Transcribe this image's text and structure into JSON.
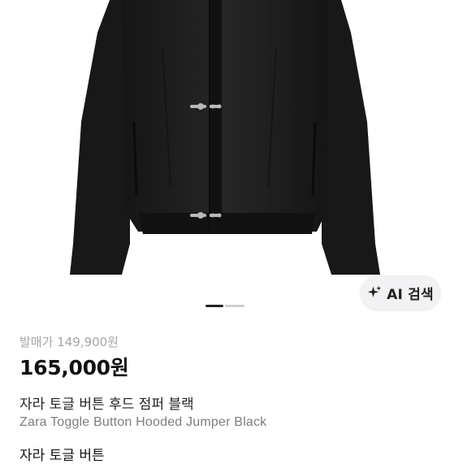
{
  "product": {
    "retail_price_label": "발매가 149,900원",
    "price": "165,000원",
    "title_ko": "자라 토글 버튼 후드 점퍼 블랙",
    "title_en": "Zara Toggle Button Hooded Jumper Black",
    "partial_text": "자라 토글 버튼"
  },
  "image_carousel": {
    "ai_search_label": "AI 검색",
    "total_images": 2,
    "active_index": 0
  },
  "colors": {
    "price": "#111111",
    "retail": "#a5a5a5",
    "subtitle": "#7d7d7d",
    "jacket": "#1b1b1b"
  },
  "icons": {
    "ai": "sparkle-icon"
  }
}
